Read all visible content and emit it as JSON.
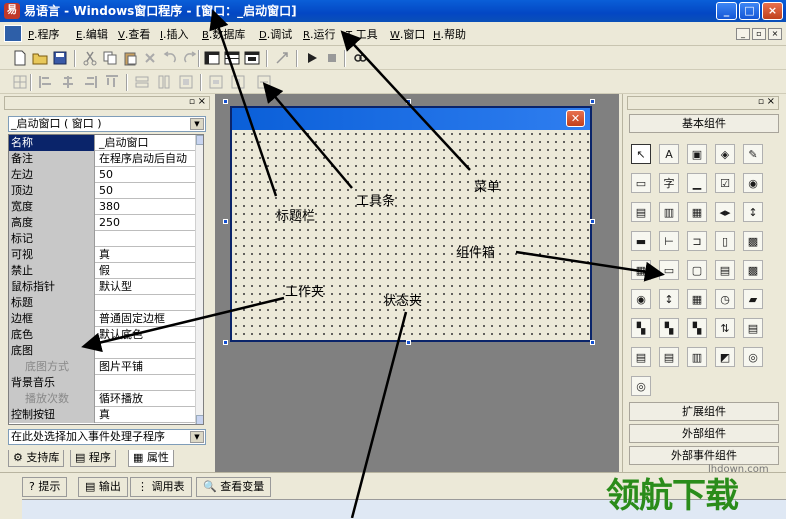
{
  "titlebar": {
    "app_icon_text": "易",
    "title": "易语言 - Windows窗口程序 - [窗口：_启动窗口]",
    "minimize": "_",
    "maximize": "□",
    "close": "×"
  },
  "menubar": {
    "items": [
      {
        "key": "P",
        "label": "程序"
      },
      {
        "key": "E",
        "label": "编辑"
      },
      {
        "key": "V",
        "label": "查看"
      },
      {
        "key": "I",
        "label": "插入"
      },
      {
        "key": "B",
        "label": "数据库"
      },
      {
        "key": "D",
        "label": "调试"
      },
      {
        "key": "R",
        "label": "运行"
      },
      {
        "key": "T",
        "label": "工具"
      },
      {
        "key": "W",
        "label": "窗口"
      },
      {
        "key": "H",
        "label": "帮助"
      }
    ]
  },
  "left_panel": {
    "object_select": "_启动窗口 ( 窗口 )",
    "properties": [
      {
        "name": "名称",
        "value": "_启动窗口",
        "selected": true
      },
      {
        "name": "备注",
        "value": "在程序启动后自动"
      },
      {
        "name": "左边",
        "value": "50"
      },
      {
        "name": "顶边",
        "value": "50"
      },
      {
        "name": "宽度",
        "value": "380"
      },
      {
        "name": "高度",
        "value": "250"
      },
      {
        "name": "标记",
        "value": ""
      },
      {
        "name": "可视",
        "value": "真"
      },
      {
        "name": "禁止",
        "value": "假"
      },
      {
        "name": "鼠标指针",
        "value": "默认型"
      },
      {
        "name": "标题",
        "value": ""
      },
      {
        "name": "边框",
        "value": "普通固定边框"
      },
      {
        "name": "底色",
        "value": "默认底色"
      },
      {
        "name": "底图",
        "value": ""
      },
      {
        "name": "底图方式",
        "value": "图片平铺",
        "sub": true
      },
      {
        "name": "背景音乐",
        "value": ""
      },
      {
        "name": "播放次数",
        "value": "循环播放",
        "sub": true
      },
      {
        "name": "控制按钮",
        "value": "真"
      }
    ],
    "event_select": "在此处选择加入事件处理子程序",
    "tabs": [
      "支持库",
      "程序",
      "属性"
    ]
  },
  "right_panel": {
    "basic_components": "基本组件",
    "component_glyphs": [
      "↖",
      "A",
      "▣",
      "◈",
      "✎",
      "▭",
      "字",
      "▁",
      "☑",
      "◉",
      "▤",
      "▥",
      "▦",
      "◂▸",
      "↕",
      "▬",
      "⊢",
      "⊐",
      "▯",
      "▩",
      "▦",
      "▭",
      "▢",
      "▤",
      "▩",
      "◉",
      "↕",
      "▦",
      "◷",
      "▰",
      "▚",
      "▚",
      "▚",
      "⇅",
      "▤",
      "▤",
      "▤",
      "▥",
      "◩",
      "◎",
      "◎"
    ],
    "groups": [
      "扩展组件",
      "外部组件",
      "外部事件组件"
    ]
  },
  "bottom": {
    "tabs": [
      "提示",
      "输出",
      "调用表",
      "查看变量"
    ]
  },
  "annotations": {
    "title_bar": "标题栏",
    "toolbar": "工具条",
    "menu": "菜单",
    "component_box": "组件箱",
    "work_folder": "工作夹",
    "status_folder": "状态夹"
  },
  "watermark": {
    "text": "领航下载",
    "url": "lhdown.com"
  }
}
